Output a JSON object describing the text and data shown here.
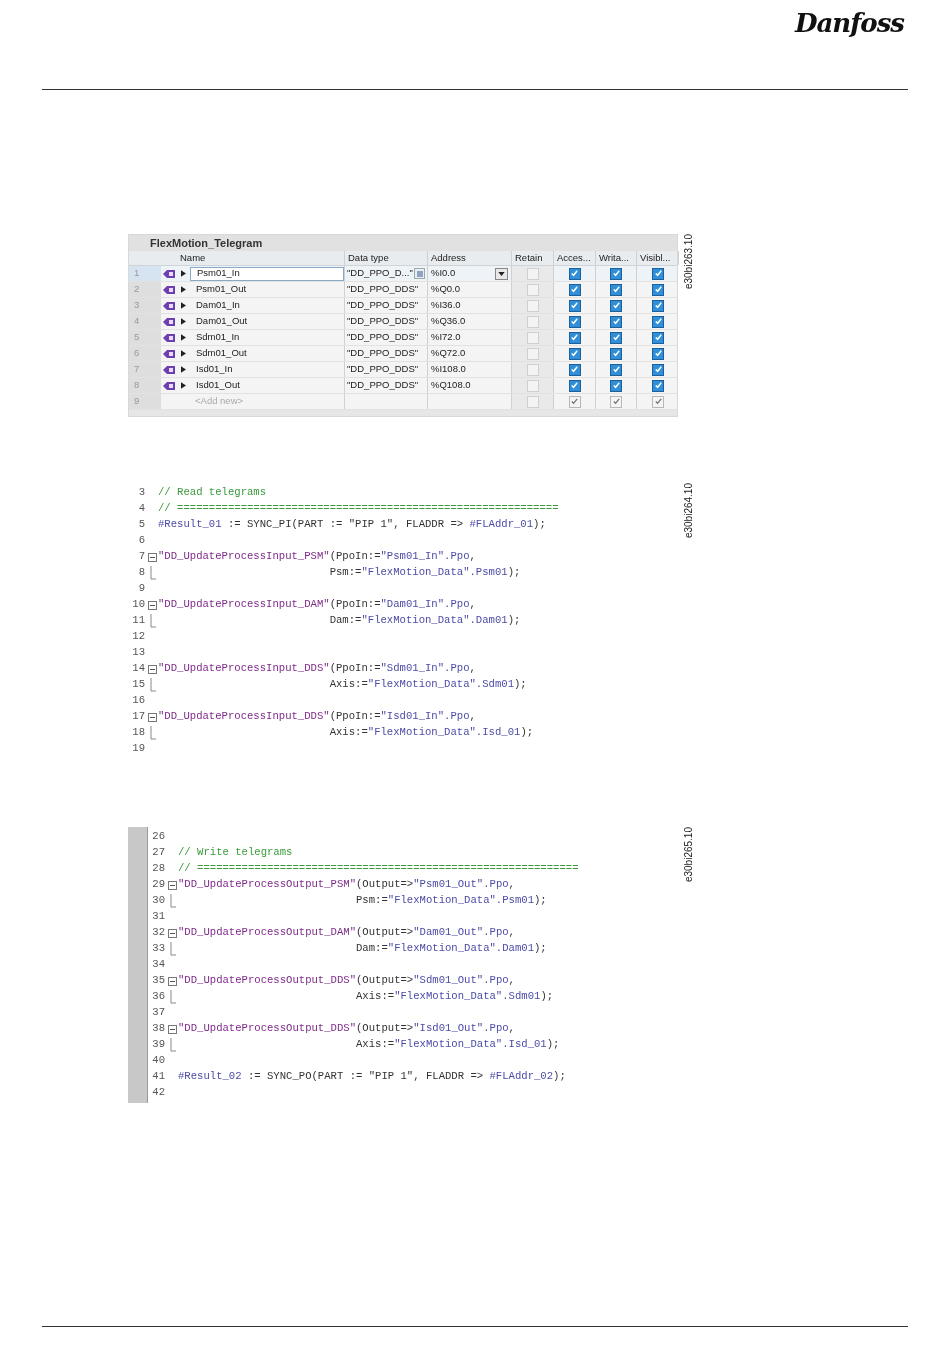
{
  "logo": "Danfoss",
  "tag_table": {
    "figure_code": "e30bi263.10",
    "title": "FlexMotion_Telegram",
    "columns": [
      "Name",
      "Data type",
      "Address",
      "Retain",
      "Acces...",
      "Writa...",
      "Visibl..."
    ],
    "rows": [
      {
        "kind": "tag",
        "number": "1",
        "name": "Psm01_In",
        "data_type": "\"DD_PPO_D...\"",
        "address": "%I0.0",
        "retain": false,
        "accessible": true,
        "writable": true,
        "visible": true,
        "selected": true
      },
      {
        "kind": "tag",
        "number": "2",
        "name": "Psm01_Out",
        "data_type": "\"DD_PPO_DDS\"",
        "address": "%Q0.0",
        "retain": false,
        "accessible": true,
        "writable": true,
        "visible": true,
        "selected": false
      },
      {
        "kind": "tag",
        "number": "3",
        "name": "Dam01_In",
        "data_type": "\"DD_PPO_DDS\"",
        "address": "%I36.0",
        "retain": false,
        "accessible": true,
        "writable": true,
        "visible": true,
        "selected": false
      },
      {
        "kind": "tag",
        "number": "4",
        "name": "Dam01_Out",
        "data_type": "\"DD_PPO_DDS\"",
        "address": "%Q36.0",
        "retain": false,
        "accessible": true,
        "writable": true,
        "visible": true,
        "selected": false
      },
      {
        "kind": "tag",
        "number": "5",
        "name": "Sdm01_In",
        "data_type": "\"DD_PPO_DDS\"",
        "address": "%I72.0",
        "retain": false,
        "accessible": true,
        "writable": true,
        "visible": true,
        "selected": false
      },
      {
        "kind": "tag",
        "number": "6",
        "name": "Sdm01_Out",
        "data_type": "\"DD_PPO_DDS\"",
        "address": "%Q72.0",
        "retain": false,
        "accessible": true,
        "writable": true,
        "visible": true,
        "selected": false
      },
      {
        "kind": "tag",
        "number": "7",
        "name": "Isd01_In",
        "data_type": "\"DD_PPO_DDS\"",
        "address": "%I108.0",
        "retain": false,
        "accessible": true,
        "writable": true,
        "visible": true,
        "selected": false
      },
      {
        "kind": "tag",
        "number": "8",
        "name": "Isd01_Out",
        "data_type": "\"DD_PPO_DDS\"",
        "address": "%Q108.0",
        "retain": false,
        "accessible": true,
        "writable": true,
        "visible": true,
        "selected": false
      },
      {
        "kind": "add",
        "number": "9",
        "name": "<Add new>",
        "retain": false,
        "accessible": true,
        "writable": true,
        "visible": true,
        "selected": false
      }
    ]
  },
  "read_code": {
    "figure_code": "e30bi264.10",
    "margin": false,
    "lines": [
      {
        "number": "3",
        "kind": "plain",
        "segments": [
          {
            "kind": "comment",
            "text": "// Read telegrams"
          }
        ]
      },
      {
        "number": "4",
        "kind": "plain",
        "segments": [
          {
            "kind": "comment",
            "text": "// ============================================================"
          }
        ]
      },
      {
        "number": "5",
        "kind": "plain",
        "segments": [
          {
            "kind": "var",
            "text": "#Result_01"
          },
          {
            "kind": "plain",
            "text": " := SYNC_PI(PART := \"PIP 1\", FLADDR => "
          },
          {
            "kind": "var",
            "text": "#FLAddr_01"
          },
          {
            "kind": "plain",
            "text": ");"
          }
        ]
      },
      {
        "number": "6",
        "kind": "plain"
      },
      {
        "number": "7",
        "kind": "fold_start",
        "segments": [
          {
            "kind": "func",
            "text": "\"DD_UpdateProcessInput_PSM\""
          },
          {
            "kind": "plain",
            "text": "(PpoIn:="
          },
          {
            "kind": "var",
            "text": "\"Psm01_In\".Ppo"
          },
          {
            "kind": "plain",
            "text": ","
          }
        ]
      },
      {
        "number": "8",
        "kind": "fold_end",
        "segments": [
          {
            "kind": "plain",
            "text": "                           Psm:="
          },
          {
            "kind": "var",
            "text": "\"FlexMotion_Data\".Psm01"
          },
          {
            "kind": "plain",
            "text": ");"
          }
        ]
      },
      {
        "number": "9",
        "kind": "plain"
      },
      {
        "number": "10",
        "kind": "fold_start",
        "segments": [
          {
            "kind": "func",
            "text": "\"DD_UpdateProcessInput_DAM\""
          },
          {
            "kind": "plain",
            "text": "(PpoIn:="
          },
          {
            "kind": "var",
            "text": "\"Dam01_In\".Ppo"
          },
          {
            "kind": "plain",
            "text": ","
          }
        ]
      },
      {
        "number": "11",
        "kind": "fold_end",
        "segments": [
          {
            "kind": "plain",
            "text": "                           Dam:="
          },
          {
            "kind": "var",
            "text": "\"FlexMotion_Data\".Dam01"
          },
          {
            "kind": "plain",
            "text": ");"
          }
        ]
      },
      {
        "number": "12",
        "kind": "plain"
      },
      {
        "number": "13",
        "kind": "plain"
      },
      {
        "number": "14",
        "kind": "fold_start",
        "segments": [
          {
            "kind": "func",
            "text": "\"DD_UpdateProcessInput_DDS\""
          },
          {
            "kind": "plain",
            "text": "(PpoIn:="
          },
          {
            "kind": "var",
            "text": "\"Sdm01_In\".Ppo"
          },
          {
            "kind": "plain",
            "text": ","
          }
        ]
      },
      {
        "number": "15",
        "kind": "fold_end",
        "segments": [
          {
            "kind": "plain",
            "text": "                           Axis:="
          },
          {
            "kind": "var",
            "text": "\"FlexMotion_Data\".Sdm01"
          },
          {
            "kind": "plain",
            "text": ");"
          }
        ]
      },
      {
        "number": "16",
        "kind": "plain"
      },
      {
        "number": "17",
        "kind": "fold_start",
        "segments": [
          {
            "kind": "func",
            "text": "\"DD_UpdateProcessInput_DDS\""
          },
          {
            "kind": "plain",
            "text": "(PpoIn:="
          },
          {
            "kind": "var",
            "text": "\"Isd01_In\".Ppo"
          },
          {
            "kind": "plain",
            "text": ","
          }
        ]
      },
      {
        "number": "18",
        "kind": "fold_end",
        "segments": [
          {
            "kind": "plain",
            "text": "                           Axis:="
          },
          {
            "kind": "var",
            "text": "\"FlexMotion_Data\".Isd_01"
          },
          {
            "kind": "plain",
            "text": ");"
          }
        ]
      },
      {
        "number": "19",
        "kind": "plain"
      }
    ]
  },
  "write_code": {
    "figure_code": "e30bi265.10",
    "margin": true,
    "lines": [
      {
        "number": "26",
        "kind": "plain"
      },
      {
        "number": "27",
        "kind": "plain",
        "segments": [
          {
            "kind": "comment",
            "text": "// Write telegrams"
          }
        ]
      },
      {
        "number": "28",
        "kind": "plain",
        "segments": [
          {
            "kind": "comment",
            "text": "// ============================================================"
          }
        ]
      },
      {
        "number": "29",
        "kind": "fold_start",
        "segments": [
          {
            "kind": "func",
            "text": "\"DD_UpdateProcessOutput_PSM\""
          },
          {
            "kind": "plain",
            "text": "(Output=>"
          },
          {
            "kind": "var",
            "text": "\"Psm01_Out\".Ppo"
          },
          {
            "kind": "plain",
            "text": ","
          }
        ]
      },
      {
        "number": "30",
        "kind": "fold_end",
        "segments": [
          {
            "kind": "plain",
            "text": "                            Psm:="
          },
          {
            "kind": "var",
            "text": "\"FlexMotion_Data\".Psm01"
          },
          {
            "kind": "plain",
            "text": ");"
          }
        ]
      },
      {
        "number": "31",
        "kind": "plain"
      },
      {
        "number": "32",
        "kind": "fold_start",
        "segments": [
          {
            "kind": "func",
            "text": "\"DD_UpdateProcessOutput_DAM\""
          },
          {
            "kind": "plain",
            "text": "(Output=>"
          },
          {
            "kind": "var",
            "text": "\"Dam01_Out\".Ppo"
          },
          {
            "kind": "plain",
            "text": ","
          }
        ]
      },
      {
        "number": "33",
        "kind": "fold_end",
        "segments": [
          {
            "kind": "plain",
            "text": "                            Dam:="
          },
          {
            "kind": "var",
            "text": "\"FlexMotion_Data\".Dam01"
          },
          {
            "kind": "plain",
            "text": ");"
          }
        ]
      },
      {
        "number": "34",
        "kind": "plain"
      },
      {
        "number": "35",
        "kind": "fold_start",
        "segments": [
          {
            "kind": "func",
            "text": "\"DD_UpdateProcessOutput_DDS\""
          },
          {
            "kind": "plain",
            "text": "(Output=>"
          },
          {
            "kind": "var",
            "text": "\"Sdm01_Out\".Ppo"
          },
          {
            "kind": "plain",
            "text": ","
          }
        ]
      },
      {
        "number": "36",
        "kind": "fold_end",
        "segments": [
          {
            "kind": "plain",
            "text": "                            Axis:="
          },
          {
            "kind": "var",
            "text": "\"FlexMotion_Data\".Sdm01"
          },
          {
            "kind": "plain",
            "text": ");"
          }
        ]
      },
      {
        "number": "37",
        "kind": "plain"
      },
      {
        "number": "38",
        "kind": "fold_start",
        "segments": [
          {
            "kind": "func",
            "text": "\"DD_UpdateProcessOutput_DDS\""
          },
          {
            "kind": "plain",
            "text": "(Output=>"
          },
          {
            "kind": "var",
            "text": "\"Isd01_Out\".Ppo"
          },
          {
            "kind": "plain",
            "text": ","
          }
        ]
      },
      {
        "number": "39",
        "kind": "fold_end",
        "segments": [
          {
            "kind": "plain",
            "text": "                            Axis:="
          },
          {
            "kind": "var",
            "text": "\"FlexMotion_Data\".Isd_01"
          },
          {
            "kind": "plain",
            "text": ");"
          }
        ]
      },
      {
        "number": "40",
        "kind": "plain"
      },
      {
        "number": "41",
        "kind": "plain",
        "segments": [
          {
            "kind": "var",
            "text": "#Result_02"
          },
          {
            "kind": "plain",
            "text": " := SYNC_PO(PART := \"PIP 1\", FLADDR => "
          },
          {
            "kind": "var",
            "text": "#FLAddr_02"
          },
          {
            "kind": "plain",
            "text": ");"
          }
        ]
      },
      {
        "number": "42",
        "kind": "plain"
      }
    ]
  }
}
